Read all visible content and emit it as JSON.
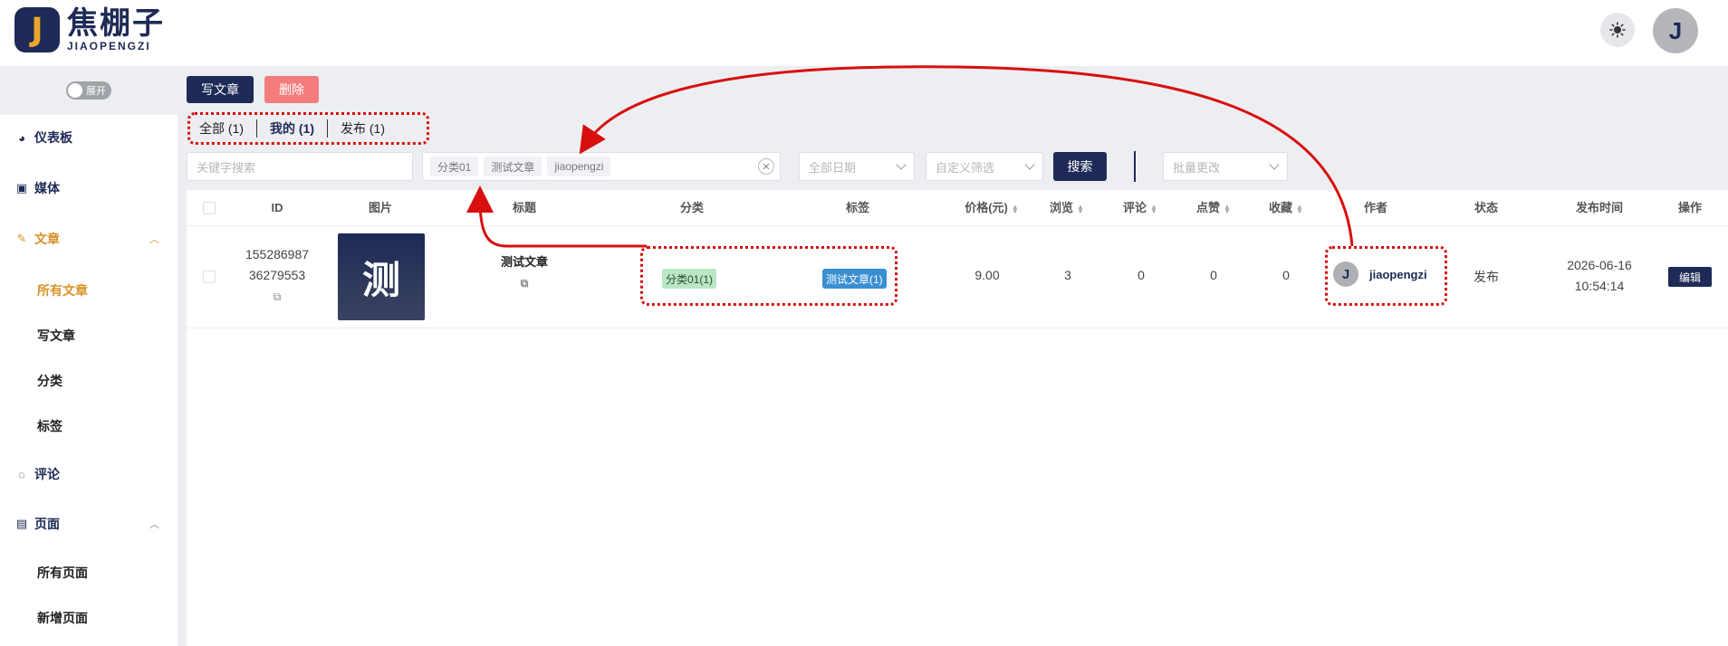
{
  "header": {
    "logo_mark": "J",
    "logo_cn": "焦棚子",
    "logo_en": "JIAOPENGZI",
    "theme_icon": "sun-icon",
    "avatar_letter": "J"
  },
  "sidebar": {
    "toggle_label": "展开",
    "items": [
      {
        "label": "仪表板",
        "icon": "dashboard-icon"
      },
      {
        "label": "媒体",
        "icon": "image-icon"
      },
      {
        "label": "文章",
        "icon": "edit-icon",
        "active": true,
        "expanded": true
      },
      {
        "label": "评论",
        "icon": "comment-icon"
      },
      {
        "label": "页面",
        "icon": "page-icon",
        "expanded": true
      }
    ],
    "article_sub": [
      "所有文章",
      "写文章",
      "分类",
      "标签"
    ],
    "page_sub": [
      "所有页面",
      "新增页面"
    ]
  },
  "toolbar": {
    "write_label": "写文章",
    "delete_label": "删除"
  },
  "tabs": [
    {
      "label": "全部 (1)"
    },
    {
      "label": "我的 (1)",
      "active": true
    },
    {
      "label": "发布 (1)"
    }
  ],
  "filters": {
    "keyword_placeholder": "关键字搜索",
    "chips": [
      "分类01",
      "测试文章",
      "jiaopengzi"
    ],
    "date_select": "全部日期",
    "custom_select": "自定义筛选",
    "search_label": "搜索",
    "batch_select": "批量更改"
  },
  "table": {
    "columns": [
      "ID",
      "图片",
      "标题",
      "分类",
      "标签",
      "价格(元)",
      "浏览",
      "评论",
      "点赞",
      "收藏",
      "作者",
      "状态",
      "发布时间",
      "操作"
    ],
    "rows": [
      {
        "id_line1": "155286987",
        "id_line2": "36279553",
        "thumb_char": "测",
        "title": "测试文章",
        "category": "分类01(1)",
        "tag": "测试文章(1)",
        "price": "9.00",
        "views": "3",
        "comments": "0",
        "likes": "0",
        "favorites": "0",
        "author_letter": "J",
        "author": "jiaopengzi",
        "status": "发布",
        "date_line1": "2026-06-16",
        "date_line2": "10:54:14",
        "edit_label": "编辑"
      }
    ]
  },
  "colors": {
    "primary": "#1e2a57",
    "accent": "#d9922a",
    "danger": "#f47c7c",
    "annotation": "#d80f0f"
  }
}
